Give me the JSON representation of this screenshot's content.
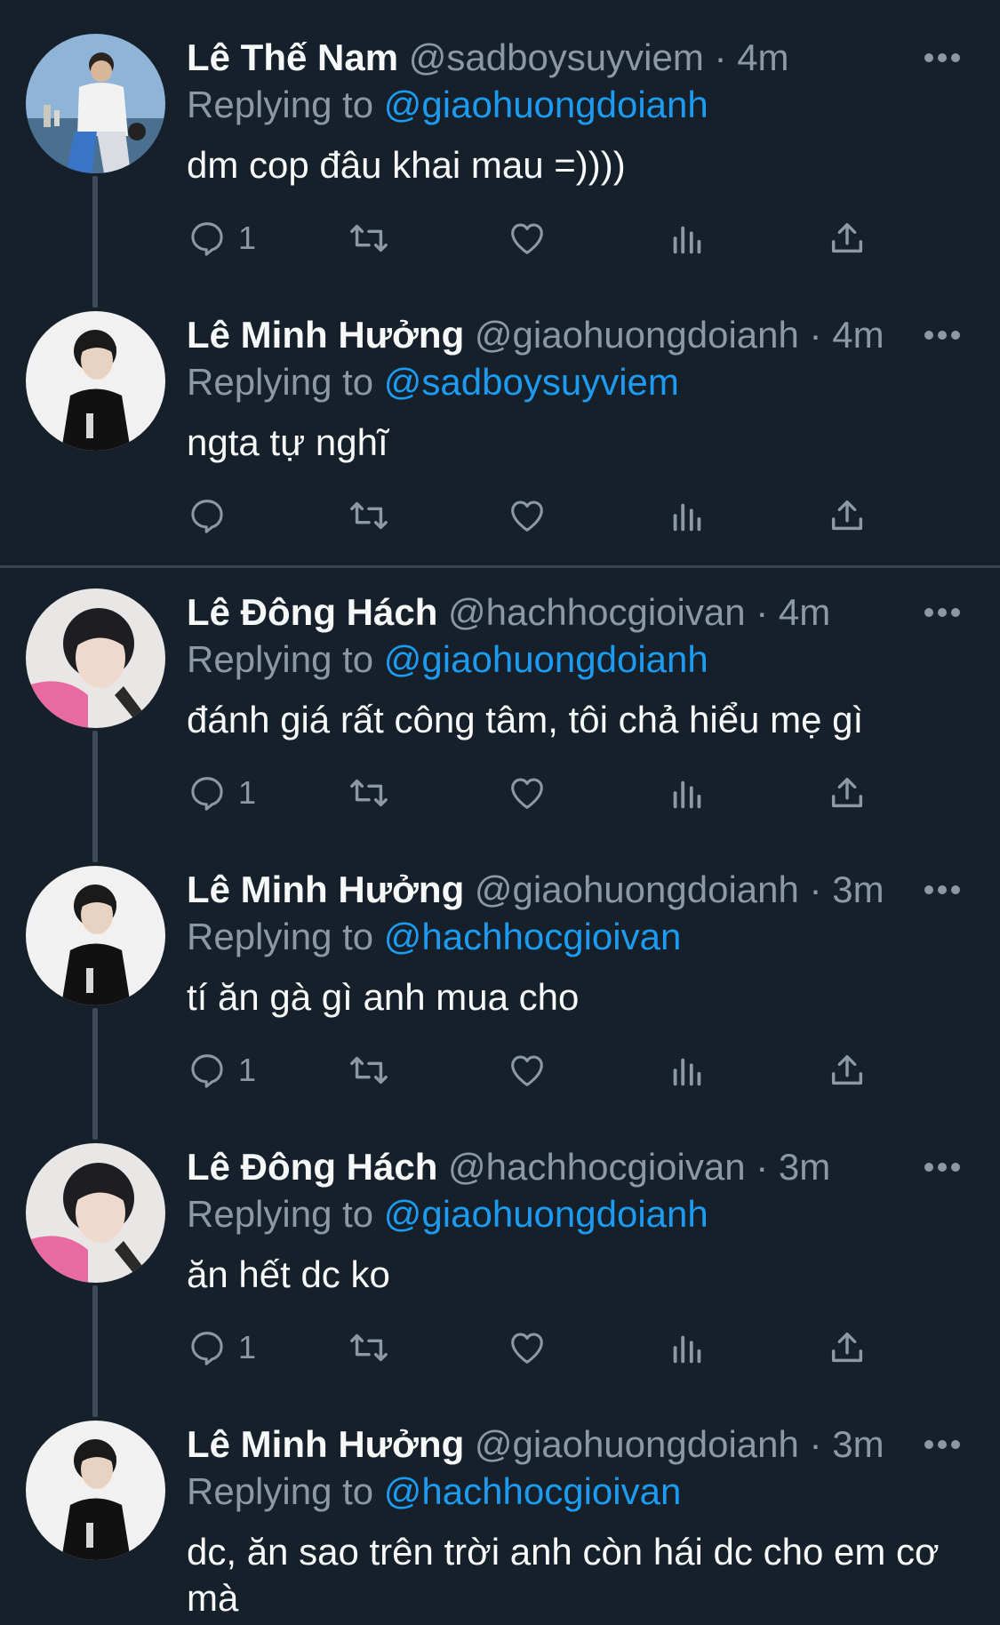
{
  "colors": {
    "background": "#15202b",
    "text": "#f7f9f9",
    "secondary": "#8b98a5",
    "link": "#1d9bf0",
    "divider": "#38444d"
  },
  "icons": [
    "reply-icon",
    "retweet-icon",
    "like-icon",
    "views-icon",
    "share-icon",
    "more-icon"
  ],
  "tweets": [
    {
      "name": "Lê Thế Nam",
      "handle": "@sadboysuyviem",
      "dot": "·",
      "time": "4m",
      "replying_prefix": "Replying to",
      "replying_to": "@giaohuongdoianh",
      "text": "dm cop đâu khai mau =))))",
      "reply_count": "1",
      "avatar": "beach-photo"
    },
    {
      "name": "Lê Minh Hưởng",
      "handle": "@giaohuongdoianh",
      "dot": "·",
      "time": "4m",
      "replying_prefix": "Replying to",
      "replying_to": "@sadboysuyviem",
      "text": "ngta tự nghĩ",
      "reply_count": "",
      "avatar": "black-hoodie-photo"
    },
    {
      "name": "Lê Đông Hách",
      "handle": "@hachhocgioivan",
      "dot": "·",
      "time": "4m",
      "replying_prefix": "Replying to",
      "replying_to": "@giaohuongdoianh",
      "text": "đánh giá rất công tâm, tôi chả hiểu mẹ gì",
      "reply_count": "1",
      "avatar": "pink-hoodie-photo"
    },
    {
      "name": "Lê Minh Hưởng",
      "handle": "@giaohuongdoianh",
      "dot": "·",
      "time": "3m",
      "replying_prefix": "Replying to",
      "replying_to": "@hachhocgioivan",
      "text": "tí ăn gà gì anh mua cho",
      "reply_count": "1",
      "avatar": "black-hoodie-photo"
    },
    {
      "name": "Lê Đông Hách",
      "handle": "@hachhocgioivan",
      "dot": "·",
      "time": "3m",
      "replying_prefix": "Replying to",
      "replying_to": "@giaohuongdoianh",
      "text": "ăn hết dc ko",
      "reply_count": "1",
      "avatar": "pink-hoodie-photo"
    },
    {
      "name": "Lê Minh Hưởng",
      "handle": "@giaohuongdoianh",
      "dot": "·",
      "time": "3m",
      "replying_prefix": "Replying to",
      "replying_to": "@hachhocgioivan",
      "text": "dc, ăn sao trên trời anh còn hái dc cho em cơ mà",
      "reply_count": "",
      "avatar": "black-hoodie-photo"
    }
  ]
}
